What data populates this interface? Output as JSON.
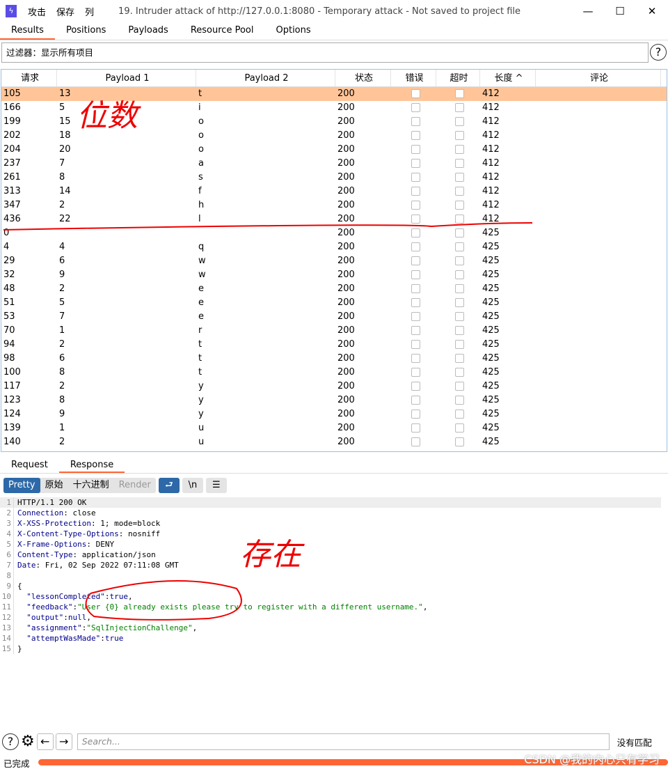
{
  "window": {
    "menu": [
      "攻击",
      "保存",
      "列"
    ],
    "title": "19. Intruder attack of http://127.0.0.1:8080 - Temporary attack - Not saved to project file",
    "controls": [
      "—",
      "☐",
      "✕"
    ]
  },
  "tabs": [
    "Results",
    "Positions",
    "Payloads",
    "Resource Pool",
    "Options"
  ],
  "filter": "过滤器：显示所有项目",
  "table": {
    "headers": [
      "请求",
      "Payload 1",
      "Payload 2",
      "状态",
      "错误",
      "超时",
      "长度 ^",
      "评论"
    ],
    "rows": [
      [
        "105",
        "13",
        "t",
        "200",
        "412"
      ],
      [
        "166",
        "5",
        "i",
        "200",
        "412"
      ],
      [
        "199",
        "15",
        "o",
        "200",
        "412"
      ],
      [
        "202",
        "18",
        "o",
        "200",
        "412"
      ],
      [
        "204",
        "20",
        "o",
        "200",
        "412"
      ],
      [
        "237",
        "7",
        "a",
        "200",
        "412"
      ],
      [
        "261",
        "8",
        "s",
        "200",
        "412"
      ],
      [
        "313",
        "14",
        "f",
        "200",
        "412"
      ],
      [
        "347",
        "2",
        "h",
        "200",
        "412"
      ],
      [
        "436",
        "22",
        "l",
        "200",
        "412"
      ],
      [
        "0",
        "",
        "",
        "200",
        "425"
      ],
      [
        "4",
        "4",
        "q",
        "200",
        "425"
      ],
      [
        "29",
        "6",
        "w",
        "200",
        "425"
      ],
      [
        "32",
        "9",
        "w",
        "200",
        "425"
      ],
      [
        "48",
        "2",
        "e",
        "200",
        "425"
      ],
      [
        "51",
        "5",
        "e",
        "200",
        "425"
      ],
      [
        "53",
        "7",
        "e",
        "200",
        "425"
      ],
      [
        "70",
        "1",
        "r",
        "200",
        "425"
      ],
      [
        "94",
        "2",
        "t",
        "200",
        "425"
      ],
      [
        "98",
        "6",
        "t",
        "200",
        "425"
      ],
      [
        "100",
        "8",
        "t",
        "200",
        "425"
      ],
      [
        "117",
        "2",
        "y",
        "200",
        "425"
      ],
      [
        "123",
        "8",
        "y",
        "200",
        "425"
      ],
      [
        "124",
        "9",
        "y",
        "200",
        "425"
      ],
      [
        "139",
        "1",
        "u",
        "200",
        "425"
      ],
      [
        "140",
        "2",
        "u",
        "200",
        "425"
      ]
    ]
  },
  "resp_tabs": [
    "Request",
    "Response"
  ],
  "view": {
    "modes": [
      "Pretty",
      "原始",
      "十六进制",
      "Render"
    ],
    "icons": [
      "wrap-icon",
      "\\n",
      "menu-icon"
    ]
  },
  "code": [
    [
      [
        "v",
        "HTTP/1.1 200 OK"
      ]
    ],
    [
      [
        "k",
        "Connection"
      ],
      [
        "v",
        ": close"
      ]
    ],
    [
      [
        "k",
        "X-XSS-Protection"
      ],
      [
        "v",
        ": 1; mode=block"
      ]
    ],
    [
      [
        "k",
        "X-Content-Type-Options"
      ],
      [
        "v",
        ": nosniff"
      ]
    ],
    [
      [
        "k",
        "X-Frame-Options"
      ],
      [
        "v",
        ": DENY"
      ]
    ],
    [
      [
        "k",
        "Content-Type"
      ],
      [
        "v",
        ": application/json"
      ]
    ],
    [
      [
        "k",
        "Date"
      ],
      [
        "v",
        ": Fri, 02 Sep 2022 07:11:08 GMT"
      ]
    ],
    [],
    [
      [
        "v",
        "{"
      ]
    ],
    [
      [
        "k",
        "  \"lessonCompleted\""
      ],
      [
        "v",
        ":"
      ],
      [
        "k",
        "true"
      ],
      [
        "v",
        ","
      ]
    ],
    [
      [
        "k",
        "  \"feedback\""
      ],
      [
        "v",
        ":"
      ],
      [
        "s",
        "\"User {0} already exists please try to register with a different username.\""
      ],
      [
        "v",
        ","
      ]
    ],
    [
      [
        "k",
        "  \"output\""
      ],
      [
        "v",
        ":"
      ],
      [
        "k",
        "null"
      ],
      [
        "v",
        ","
      ]
    ],
    [
      [
        "k",
        "  \"assignment\""
      ],
      [
        "v",
        ":"
      ],
      [
        "s",
        "\"SqlInjectionChallenge\""
      ],
      [
        "v",
        ","
      ]
    ],
    [
      [
        "k",
        "  \"attemptWasMade\""
      ],
      [
        "v",
        ":"
      ],
      [
        "k",
        "true"
      ]
    ],
    [
      [
        "v",
        "}"
      ]
    ]
  ],
  "bottom": {
    "search_placeholder": "Search...",
    "match": "没有匹配",
    "status": "已完成",
    "progress": 100
  },
  "annotations": {
    "a1": "位数",
    "a2": "存在",
    "watermark": "CSDN @我的内心只有学习"
  },
  "colors": {
    "accent": "#ff6633",
    "selected_row": "#ffc599",
    "button_blue": "#2d69a8"
  }
}
